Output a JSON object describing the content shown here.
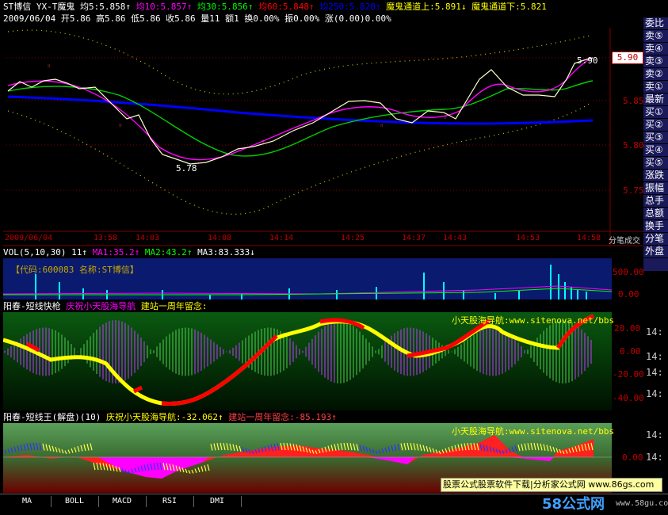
{
  "main": {
    "title": "ST博信 YX-T魔鬼",
    "ma5": "均5:5.858",
    "ma10": "均10:5.857",
    "ma30": "均30:5.856",
    "ma60": "均60:5.848",
    "ma250": "均250:5.828",
    "upper": "魔鬼通道上:5.891",
    "lower": "魔鬼通道下:5.821",
    "info": "2009/06/04 开5.86 高5.86 低5.86 收5.86 量11 额1 换0.00% 振0.00% 涨(0.00)0.00%",
    "price_tag": "5.90",
    "high_label": "5.90",
    "low_label": "5.78",
    "y_ticks": [
      "5.85",
      "5.80",
      "5.75"
    ],
    "time_ticks": [
      "2009/06/04",
      "13:58",
      "14:03",
      "14:08",
      "14:14",
      "14:25",
      "14:37",
      "14:43",
      "14:53",
      "14:58"
    ],
    "bottom_right": "分笔成交"
  },
  "vol": {
    "header": "VOL(5,10,30) 11",
    "ma1": "MA1:35.2",
    "ma2": "MA2:43.2",
    "ma3": "MA3:83.333",
    "code_label": "【代码:600083 名称:ST博信】",
    "ticks": [
      "500.00",
      "0.00"
    ]
  },
  "ind1": {
    "title": "阳春-短线快枪",
    "sub1": "庆祝小天股海导航",
    "sub2": "建站一周年留念:",
    "watermark": "小天股海导航:www.sitenova.net/bbs",
    "ticks": [
      "20.00",
      "0.00",
      "-20.00",
      "-40.00"
    ],
    "right_ticks": [
      "14:",
      "14:",
      "14:",
      "14:"
    ]
  },
  "ind2": {
    "title": "阳春-短线王(解盘)(10)",
    "sub1": "庆祝小天股海导航:-32.062",
    "sub2": "建站一周年留念:-85.193",
    "watermark": "小天股海导航:www.sitenova.net/bbs",
    "ticks": [
      "0.00"
    ],
    "right_ticks": [
      "14:",
      "14:"
    ],
    "banner": "股票公式股票软件下载|分析家公式网 www.86gs.com"
  },
  "right_panel": [
    "委比",
    "卖⑤",
    "卖④",
    "卖③",
    "卖②",
    "卖①",
    "最新",
    "买①",
    "买②",
    "买③",
    "买④",
    "买⑤",
    "涨跌",
    "振幅",
    "总手",
    "总额",
    "换手",
    "分笔",
    "外盘"
  ],
  "tabs": [
    "MA",
    "BOLL",
    "MACD",
    "RSI",
    "DMI"
  ],
  "logo": "58公式网",
  "logo_url": "www.58gu.com",
  "colors": {
    "ma5": "#ffffff",
    "ma10": "#ff00ff",
    "ma30": "#00ff00",
    "ma60": "#ff0000",
    "ma250": "#0000ff",
    "accent": "#ffff00"
  }
}
